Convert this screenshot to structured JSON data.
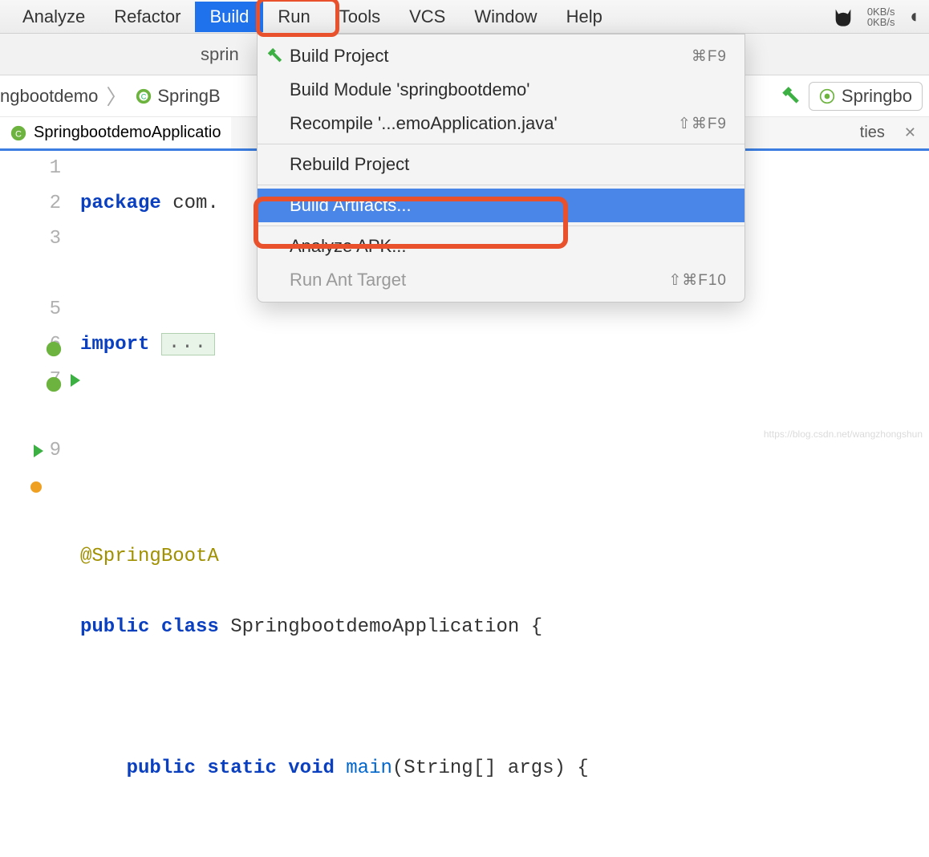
{
  "menubar": {
    "items": [
      {
        "label": "Analyze"
      },
      {
        "label": "Refactor"
      },
      {
        "label": "Build",
        "active": true
      },
      {
        "label": "Run"
      },
      {
        "label": "Tools"
      },
      {
        "label": "VCS"
      },
      {
        "label": "Window"
      },
      {
        "label": "Help"
      }
    ],
    "net_up": "0KB/s",
    "net_down": "0KB/s"
  },
  "subbar": {
    "text": "sprin"
  },
  "breadcrumb": {
    "item1": "ngbootdemo",
    "item2": "SpringB",
    "run_config": "Springbo"
  },
  "tab": {
    "filename": "SpringbootdemoApplicatio",
    "suffix": "ties"
  },
  "dropdown": {
    "items": [
      {
        "label": "Build Project",
        "shortcut": "⌘F9",
        "has_icon": true
      },
      {
        "label": "Build Module 'springbootdemo'"
      },
      {
        "label": "Recompile '...emoApplication.java'",
        "shortcut": "⇧⌘F9"
      },
      {
        "sep": true
      },
      {
        "label": "Rebuild Project"
      },
      {
        "sep": true
      },
      {
        "label": "Build Artifacts...",
        "selected": true
      },
      {
        "sep": true
      },
      {
        "label": "Analyze APK..."
      },
      {
        "label": "Run Ant Target",
        "shortcut": "⇧⌘F10",
        "disabled": true
      }
    ]
  },
  "code": {
    "line1_kw": "package",
    "line1_rest": " com.",
    "line3_kw": "import",
    "line3_fold": "...",
    "line6_ann": "@SpringBootA",
    "line7_a": "public",
    "line7_b": " class",
    "line7_c": " SpringbootdemoApplication {",
    "line9_a": "public",
    "line9_b": " static",
    "line9_c": " void",
    "line9_m": " main",
    "line9_d": "(String[] args) {"
  },
  "gutter": [
    "1",
    "2",
    "3",
    "",
    "5",
    "6",
    "7",
    "",
    "9",
    ""
  ],
  "watermark": "https://blog.csdn.net/wangzhongshun"
}
